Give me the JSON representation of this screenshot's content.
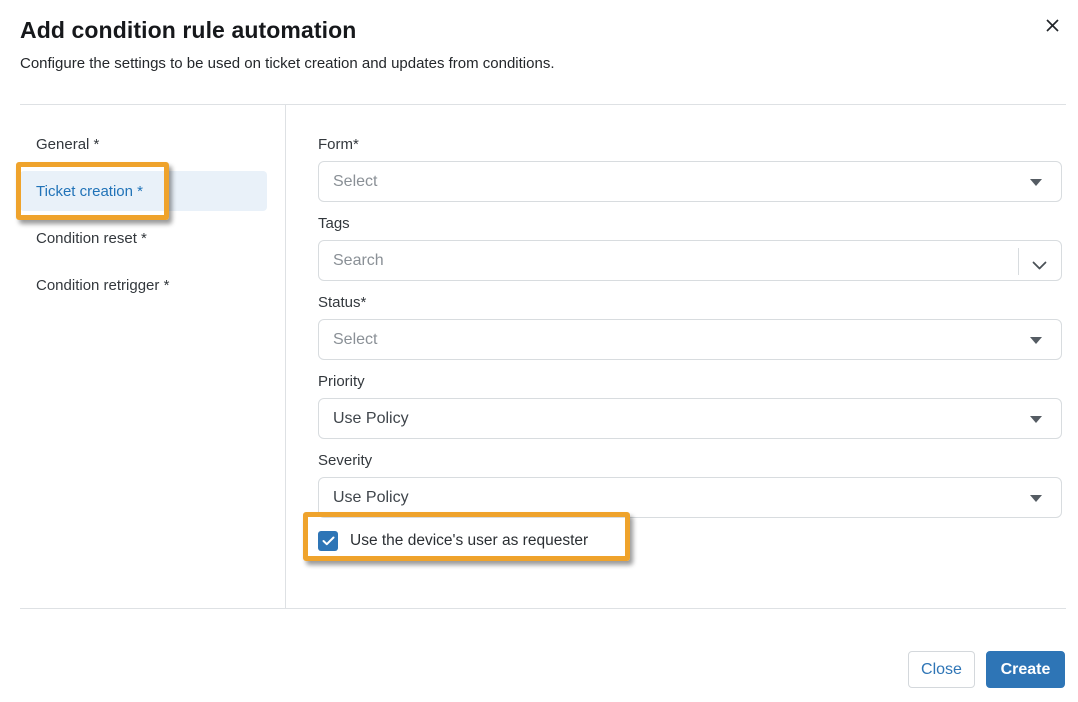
{
  "modal": {
    "title": "Add condition rule automation",
    "subtitle": "Configure the settings to be used on ticket creation and updates from conditions."
  },
  "sidebar": {
    "items": [
      {
        "label": "General *",
        "selected": false
      },
      {
        "label": "Ticket creation *",
        "selected": true
      },
      {
        "label": "Condition reset *",
        "selected": false
      },
      {
        "label": "Condition retrigger *",
        "selected": false
      }
    ]
  },
  "form": {
    "fields": [
      {
        "label": "Form*",
        "value": "Select",
        "is_placeholder": true,
        "control": "select"
      },
      {
        "label": "Tags",
        "value": "Search",
        "is_placeholder": true,
        "control": "combobox"
      },
      {
        "label": "Status*",
        "value": "Select",
        "is_placeholder": true,
        "control": "select"
      },
      {
        "label": "Priority",
        "value": "Use Policy",
        "is_placeholder": false,
        "control": "select"
      },
      {
        "label": "Severity",
        "value": "Use Policy",
        "is_placeholder": false,
        "control": "select"
      }
    ],
    "checkbox": {
      "label": "Use the device's user as requester",
      "checked": true
    }
  },
  "footer": {
    "close_label": "Close",
    "create_label": "Create"
  },
  "annotations": {
    "highlight_color": "#efa32c",
    "highlighted_elements": [
      "ticket-creation-tab",
      "requester-checkbox"
    ]
  },
  "colors": {
    "accent_blue": "#2e75b6",
    "selected_tab_text": "#2173b8",
    "selected_tab_bg": "#e9f1f9",
    "annotation_orange": "#efa32c",
    "placeholder_gray": "#8a9096",
    "border_gray": "#d8dcdf"
  }
}
